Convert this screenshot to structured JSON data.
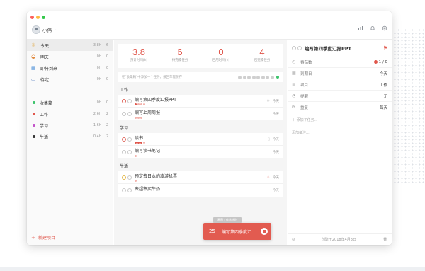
{
  "window": {
    "lights": [
      "#fc605c",
      "#fdbc40",
      "#34c84a"
    ]
  },
  "user": {
    "name": "小伟"
  },
  "top_icons": [
    "stats-icon",
    "bell-icon",
    "settings-icon"
  ],
  "sidebar": {
    "items": [
      {
        "icon": "sun-icon",
        "glyph": "☼",
        "label": "今天",
        "time": "3.8h",
        "count": "6",
        "active": true
      },
      {
        "icon": "sunrise-icon",
        "glyph": "◒",
        "label": "明天",
        "time": "0h",
        "count": "0"
      },
      {
        "icon": "calendar-icon",
        "glyph": "▦",
        "label": "即将到来",
        "time": "0h",
        "count": "0"
      },
      {
        "icon": "inbox-icon",
        "glyph": "▭",
        "label": "待定",
        "time": "0h",
        "count": "0"
      }
    ],
    "projects": [
      {
        "label": "收集箱",
        "color": "#3ec46d",
        "time": "0h",
        "count": "0"
      },
      {
        "label": "工作",
        "color": "#e0564b",
        "time": "2.6h",
        "count": "2"
      },
      {
        "label": "学习",
        "color": "#c251c9",
        "time": "1.6h",
        "count": "2"
      },
      {
        "label": "生活",
        "color": "#333333",
        "time": "0.4h",
        "count": "2"
      }
    ],
    "new_project": "新建项目"
  },
  "stats": [
    {
      "value": "3.8",
      "label": "预计时间(h)"
    },
    {
      "value": "6",
      "label": "待完成任务"
    },
    {
      "value": "0",
      "label": "已用时间(h)"
    },
    {
      "value": "4",
      "label": "已完成任务"
    }
  ],
  "add_task": {
    "placeholder": "在\"收集箱\"中添加一个任务，按回车键保存"
  },
  "groups": [
    {
      "title": "工作",
      "tasks": [
        {
          "title": "编写第四季度汇报PPT",
          "check": "r",
          "dots": [
            1,
            0,
            0,
            0
          ],
          "meta_icon": "repeat-icon",
          "date": "今天"
        },
        {
          "title": "编写上周周报",
          "check": "",
          "dots": [
            0,
            0,
            0
          ],
          "date": "今天"
        }
      ]
    },
    {
      "title": "学习",
      "tasks": [
        {
          "title": "读书",
          "check": "r",
          "dots": [
            1,
            1,
            1,
            0
          ],
          "meta_icon": "book-icon",
          "date": "今天"
        },
        {
          "title": "编写读书笔记",
          "check": "",
          "dots": [
            0
          ],
          "date": "今天"
        }
      ]
    },
    {
      "title": "生活",
      "tasks": [
        {
          "title": "预定去日本的旅游机票",
          "check": "y",
          "dots": [
            0
          ],
          "meta_icon": "bell-icon",
          "date": "今天"
        },
        {
          "title": "去超市买牛奶",
          "check": "",
          "dots": [],
          "date": "今天"
        }
      ]
    }
  ],
  "timer": {
    "tag": "番茄工作法计时",
    "count": "25",
    "title": "编写第四季度汇..."
  },
  "detail": {
    "title": "编写第四季度汇报PPT",
    "rows": [
      {
        "icon": "clock-icon",
        "glyph": "◷",
        "label": "番茄数",
        "value": "1 / 0"
      },
      {
        "icon": "calendar-icon",
        "glyph": "▦",
        "label": "到期日",
        "value": "今天"
      },
      {
        "icon": "list-icon",
        "glyph": "≡",
        "label": "项目",
        "value": "工作"
      },
      {
        "icon": "alarm-icon",
        "glyph": "◔",
        "label": "提醒",
        "value": "无"
      },
      {
        "icon": "repeat-icon",
        "glyph": "⟳",
        "label": "重复",
        "value": "每天"
      }
    ],
    "subtask_placeholder": "添加子任务...",
    "note_placeholder": "添加备注...",
    "created": "创建于2018年4月3日"
  }
}
